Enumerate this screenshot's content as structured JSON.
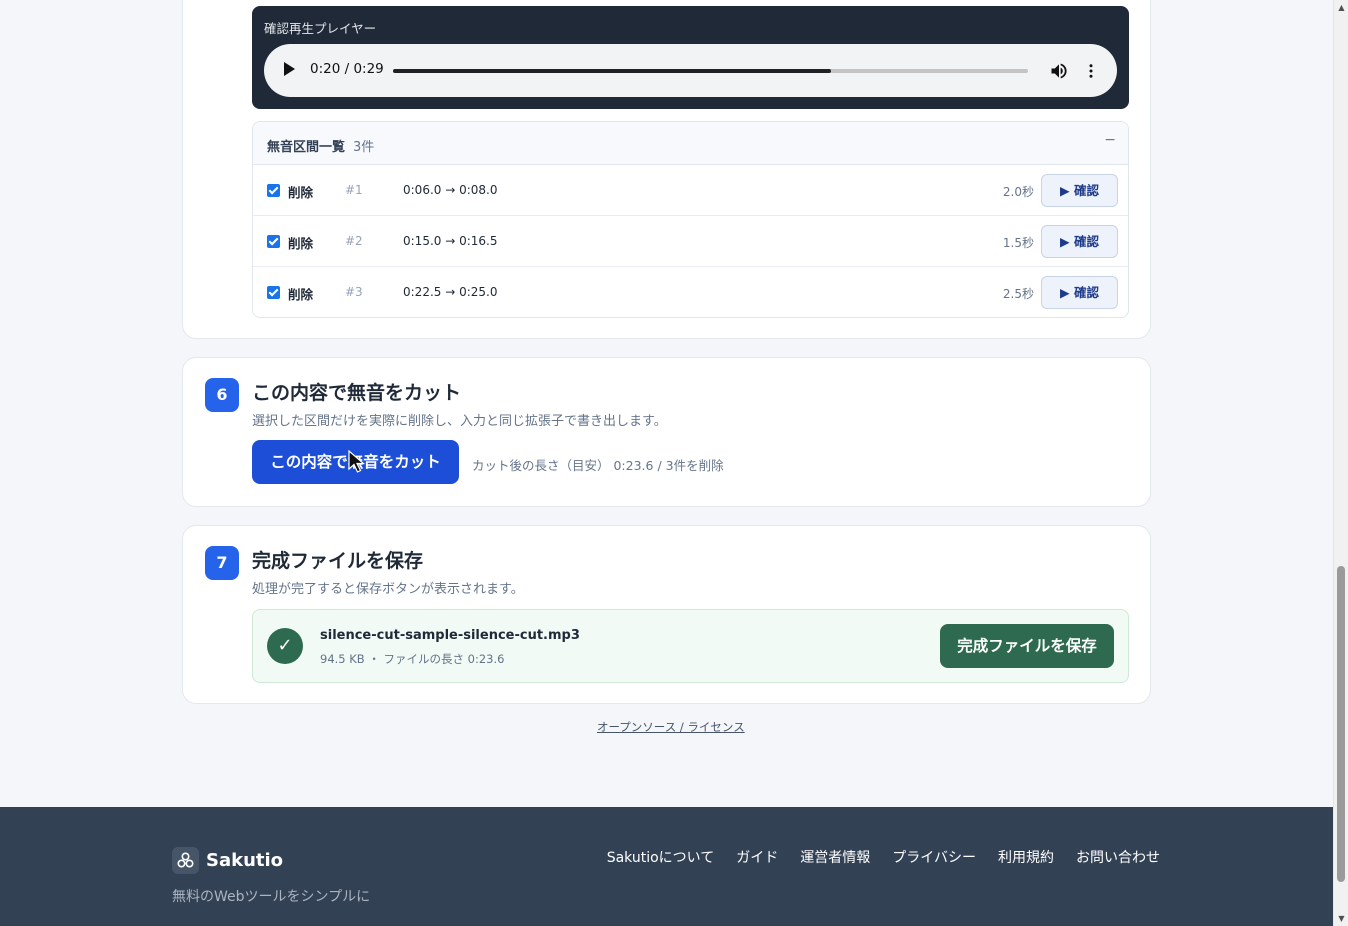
{
  "player": {
    "label": "確認再生プレイヤー",
    "time": "0:20 / 0:29",
    "progress": 0.69
  },
  "silence": {
    "title": "無音区間一覧",
    "count": "3件",
    "collapse": "−",
    "rows": [
      {
        "label": "削除",
        "idx": "#1",
        "range": "0:06.0 → 0:08.0",
        "dur": "2.0秒",
        "btn": "▶ 確認"
      },
      {
        "label": "削除",
        "idx": "#2",
        "range": "0:15.0 → 0:16.5",
        "dur": "1.5秒",
        "btn": "▶ 確認"
      },
      {
        "label": "削除",
        "idx": "#3",
        "range": "0:22.5 → 0:25.0",
        "dur": "2.5秒",
        "btn": "▶ 確認"
      }
    ]
  },
  "step6": {
    "num": "6",
    "title": "この内容で無音をカット",
    "desc": "選択した区間だけを実際に削除し、入力と同じ拡張子で書き出します。",
    "button": "この内容で無音をカット",
    "note": "カット後の長さ（目安） 0:23.6 / 3件を削除"
  },
  "step7": {
    "num": "7",
    "title": "完成ファイルを保存",
    "desc": "処理が完了すると保存ボタンが表示されます。",
    "check": "✓",
    "file_name": "silence-cut-sample-silence-cut.mp3",
    "file_meta": "94.5 KB ・ ファイルの長さ 0:23.6",
    "save_button": "完成ファイルを保存"
  },
  "oss_link": "オープンソース / ライセンス",
  "footer": {
    "brand": "Sakutio",
    "tagline": "無料のWebツールをシンプルに",
    "nav": [
      "Sakutioについて",
      "ガイド",
      "運営者情報",
      "プライバシー",
      "利用規約",
      "お問い合わせ"
    ]
  },
  "colors": {
    "accent": "#2563eb",
    "cut_button": "#1d4ed8",
    "save_green": "#2d6a4f",
    "footer_bg": "#334155"
  }
}
